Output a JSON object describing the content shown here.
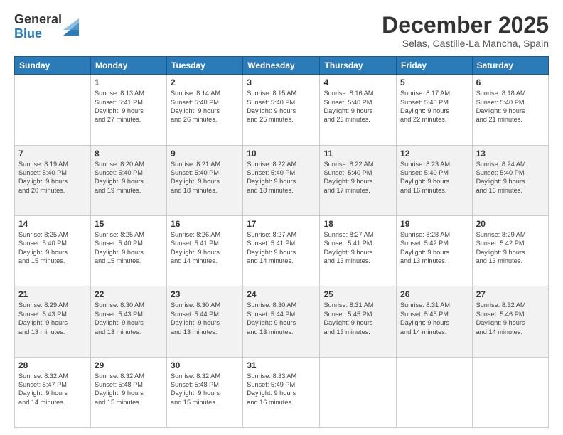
{
  "logo": {
    "general": "General",
    "blue": "Blue"
  },
  "header": {
    "title": "December 2025",
    "location": "Selas, Castille-La Mancha, Spain"
  },
  "days_of_week": [
    "Sunday",
    "Monday",
    "Tuesday",
    "Wednesday",
    "Thursday",
    "Friday",
    "Saturday"
  ],
  "weeks": [
    [
      {
        "day": "",
        "info": ""
      },
      {
        "day": "1",
        "info": "Sunrise: 8:13 AM\nSunset: 5:41 PM\nDaylight: 9 hours\nand 27 minutes."
      },
      {
        "day": "2",
        "info": "Sunrise: 8:14 AM\nSunset: 5:40 PM\nDaylight: 9 hours\nand 26 minutes."
      },
      {
        "day": "3",
        "info": "Sunrise: 8:15 AM\nSunset: 5:40 PM\nDaylight: 9 hours\nand 25 minutes."
      },
      {
        "day": "4",
        "info": "Sunrise: 8:16 AM\nSunset: 5:40 PM\nDaylight: 9 hours\nand 23 minutes."
      },
      {
        "day": "5",
        "info": "Sunrise: 8:17 AM\nSunset: 5:40 PM\nDaylight: 9 hours\nand 22 minutes."
      },
      {
        "day": "6",
        "info": "Sunrise: 8:18 AM\nSunset: 5:40 PM\nDaylight: 9 hours\nand 21 minutes."
      }
    ],
    [
      {
        "day": "7",
        "info": "Sunrise: 8:19 AM\nSunset: 5:40 PM\nDaylight: 9 hours\nand 20 minutes."
      },
      {
        "day": "8",
        "info": "Sunrise: 8:20 AM\nSunset: 5:40 PM\nDaylight: 9 hours\nand 19 minutes."
      },
      {
        "day": "9",
        "info": "Sunrise: 8:21 AM\nSunset: 5:40 PM\nDaylight: 9 hours\nand 18 minutes."
      },
      {
        "day": "10",
        "info": "Sunrise: 8:22 AM\nSunset: 5:40 PM\nDaylight: 9 hours\nand 18 minutes."
      },
      {
        "day": "11",
        "info": "Sunrise: 8:22 AM\nSunset: 5:40 PM\nDaylight: 9 hours\nand 17 minutes."
      },
      {
        "day": "12",
        "info": "Sunrise: 8:23 AM\nSunset: 5:40 PM\nDaylight: 9 hours\nand 16 minutes."
      },
      {
        "day": "13",
        "info": "Sunrise: 8:24 AM\nSunset: 5:40 PM\nDaylight: 9 hours\nand 16 minutes."
      }
    ],
    [
      {
        "day": "14",
        "info": "Sunrise: 8:25 AM\nSunset: 5:40 PM\nDaylight: 9 hours\nand 15 minutes."
      },
      {
        "day": "15",
        "info": "Sunrise: 8:25 AM\nSunset: 5:40 PM\nDaylight: 9 hours\nand 15 minutes."
      },
      {
        "day": "16",
        "info": "Sunrise: 8:26 AM\nSunset: 5:41 PM\nDaylight: 9 hours\nand 14 minutes."
      },
      {
        "day": "17",
        "info": "Sunrise: 8:27 AM\nSunset: 5:41 PM\nDaylight: 9 hours\nand 14 minutes."
      },
      {
        "day": "18",
        "info": "Sunrise: 8:27 AM\nSunset: 5:41 PM\nDaylight: 9 hours\nand 13 minutes."
      },
      {
        "day": "19",
        "info": "Sunrise: 8:28 AM\nSunset: 5:42 PM\nDaylight: 9 hours\nand 13 minutes."
      },
      {
        "day": "20",
        "info": "Sunrise: 8:29 AM\nSunset: 5:42 PM\nDaylight: 9 hours\nand 13 minutes."
      }
    ],
    [
      {
        "day": "21",
        "info": "Sunrise: 8:29 AM\nSunset: 5:43 PM\nDaylight: 9 hours\nand 13 minutes."
      },
      {
        "day": "22",
        "info": "Sunrise: 8:30 AM\nSunset: 5:43 PM\nDaylight: 9 hours\nand 13 minutes."
      },
      {
        "day": "23",
        "info": "Sunrise: 8:30 AM\nSunset: 5:44 PM\nDaylight: 9 hours\nand 13 minutes."
      },
      {
        "day": "24",
        "info": "Sunrise: 8:30 AM\nSunset: 5:44 PM\nDaylight: 9 hours\nand 13 minutes."
      },
      {
        "day": "25",
        "info": "Sunrise: 8:31 AM\nSunset: 5:45 PM\nDaylight: 9 hours\nand 13 minutes."
      },
      {
        "day": "26",
        "info": "Sunrise: 8:31 AM\nSunset: 5:45 PM\nDaylight: 9 hours\nand 14 minutes."
      },
      {
        "day": "27",
        "info": "Sunrise: 8:32 AM\nSunset: 5:46 PM\nDaylight: 9 hours\nand 14 minutes."
      }
    ],
    [
      {
        "day": "28",
        "info": "Sunrise: 8:32 AM\nSunset: 5:47 PM\nDaylight: 9 hours\nand 14 minutes."
      },
      {
        "day": "29",
        "info": "Sunrise: 8:32 AM\nSunset: 5:48 PM\nDaylight: 9 hours\nand 15 minutes."
      },
      {
        "day": "30",
        "info": "Sunrise: 8:32 AM\nSunset: 5:48 PM\nDaylight: 9 hours\nand 15 minutes."
      },
      {
        "day": "31",
        "info": "Sunrise: 8:33 AM\nSunset: 5:49 PM\nDaylight: 9 hours\nand 16 minutes."
      },
      {
        "day": "",
        "info": ""
      },
      {
        "day": "",
        "info": ""
      },
      {
        "day": "",
        "info": ""
      }
    ]
  ]
}
